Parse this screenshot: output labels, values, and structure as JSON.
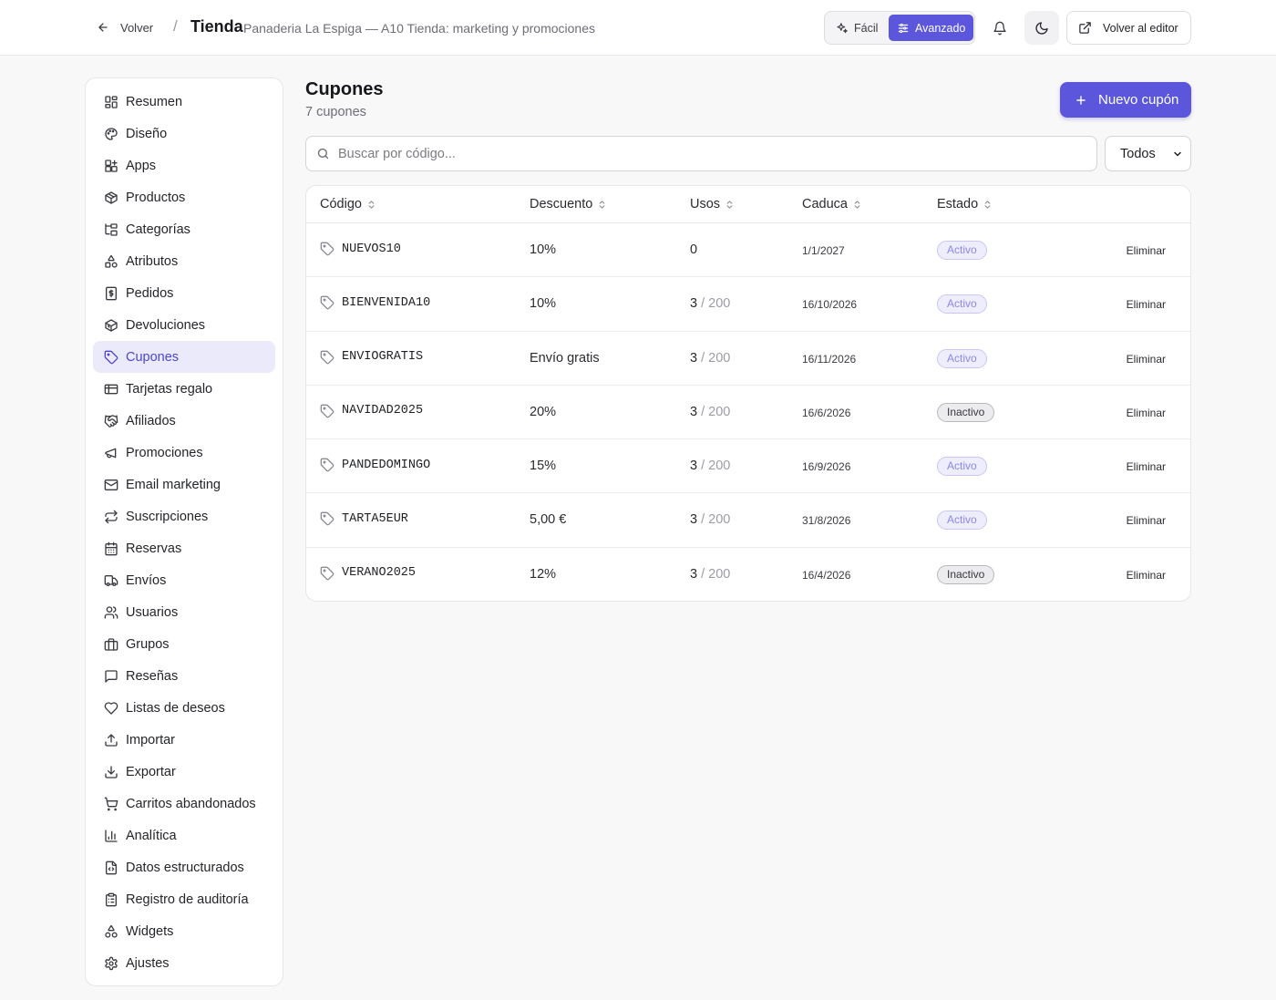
{
  "header": {
    "back_label": "Volver",
    "separator": "/",
    "title": "Tienda",
    "subtitle": "Panaderia La Espiga — A10 Tienda: marketing y promociones",
    "mode_easy": "Fácil",
    "mode_advanced": "Avanzado",
    "editor_label": "Volver al editor"
  },
  "sidebar": {
    "items": [
      {
        "label": "Resumen",
        "icon": "grid-icon"
      },
      {
        "label": "Diseño",
        "icon": "palette-icon"
      },
      {
        "label": "Apps",
        "icon": "apps-icon"
      },
      {
        "label": "Productos",
        "icon": "package-icon"
      },
      {
        "label": "Categorías",
        "icon": "categories-icon"
      },
      {
        "label": "Atributos",
        "icon": "shapes-icon"
      },
      {
        "label": "Pedidos",
        "icon": "receipt-icon"
      },
      {
        "label": "Devoluciones",
        "icon": "package-return-icon"
      },
      {
        "label": "Cupones",
        "icon": "tag-icon",
        "active": true
      },
      {
        "label": "Tarjetas regalo",
        "icon": "gift-card-icon"
      },
      {
        "label": "Afiliados",
        "icon": "handshake-icon"
      },
      {
        "label": "Promociones",
        "icon": "megaphone-icon"
      },
      {
        "label": "Email marketing",
        "icon": "mail-icon"
      },
      {
        "label": "Suscripciones",
        "icon": "repeat-icon"
      },
      {
        "label": "Reservas",
        "icon": "calendar-icon"
      },
      {
        "label": "Envíos",
        "icon": "truck-icon"
      },
      {
        "label": "Usuarios",
        "icon": "users-icon"
      },
      {
        "label": "Grupos",
        "icon": "briefcase-icon"
      },
      {
        "label": "Reseñas",
        "icon": "message-icon"
      },
      {
        "label": "Listas de deseos",
        "icon": "heart-icon"
      },
      {
        "label": "Importar",
        "icon": "upload-icon"
      },
      {
        "label": "Exportar",
        "icon": "download-icon"
      },
      {
        "label": "Carritos abandonados",
        "icon": "cart-icon"
      },
      {
        "label": "Analítica",
        "icon": "bar-chart-icon"
      },
      {
        "label": "Datos estructurados",
        "icon": "file-code-icon"
      },
      {
        "label": "Registro de auditoría",
        "icon": "clipboard-icon"
      },
      {
        "label": "Widgets",
        "icon": "widgets-icon"
      },
      {
        "label": "Ajustes",
        "icon": "gear-icon"
      }
    ]
  },
  "main": {
    "title": "Cupones",
    "count_label": "7 cupones",
    "new_button_label": "Nuevo cupón",
    "search": {
      "placeholder": "Buscar por código...",
      "value": ""
    },
    "filter": {
      "selected": "Todos",
      "options": [
        "Todos"
      ]
    },
    "table": {
      "columns": [
        "Código",
        "Descuento",
        "Usos",
        "Caduca",
        "Estado"
      ],
      "rows": [
        {
          "code": "NUEVOS10",
          "discount": "10%",
          "uses": "0",
          "max": "",
          "expires": "1/1/2027",
          "status": "Activo",
          "active": true,
          "action": "Eliminar"
        },
        {
          "code": "BIENVENIDA10",
          "discount": "10%",
          "uses": "3",
          "max": " / 200",
          "expires": "16/10/2026",
          "status": "Activo",
          "active": true,
          "action": "Eliminar"
        },
        {
          "code": "ENVIOGRATIS",
          "discount": "Envío gratis",
          "uses": "3",
          "max": " / 200",
          "expires": "16/11/2026",
          "status": "Activo",
          "active": true,
          "action": "Eliminar"
        },
        {
          "code": "NAVIDAD2025",
          "discount": "20%",
          "uses": "3",
          "max": " / 200",
          "expires": "16/6/2026",
          "status": "Inactivo",
          "active": false,
          "action": "Eliminar"
        },
        {
          "code": "PANDEDOMINGO",
          "discount": "15%",
          "uses": "3",
          "max": " / 200",
          "expires": "16/9/2026",
          "status": "Activo",
          "active": true,
          "action": "Eliminar"
        },
        {
          "code": "TARTA5EUR",
          "discount": "5,00 €",
          "uses": "3",
          "max": " / 200",
          "expires": "31/8/2026",
          "status": "Activo",
          "active": true,
          "action": "Eliminar"
        },
        {
          "code": "VERANO2025",
          "discount": "12%",
          "uses": "3",
          "max": " / 200",
          "expires": "16/4/2026",
          "status": "Inactivo",
          "active": false,
          "action": "Eliminar"
        }
      ]
    }
  },
  "colors": {
    "accent": "#5b56dc",
    "active_nav_bg": "#ebeafb",
    "badge_active_text": "#8d87e6",
    "badge_inactive_bg": "#ececef"
  }
}
